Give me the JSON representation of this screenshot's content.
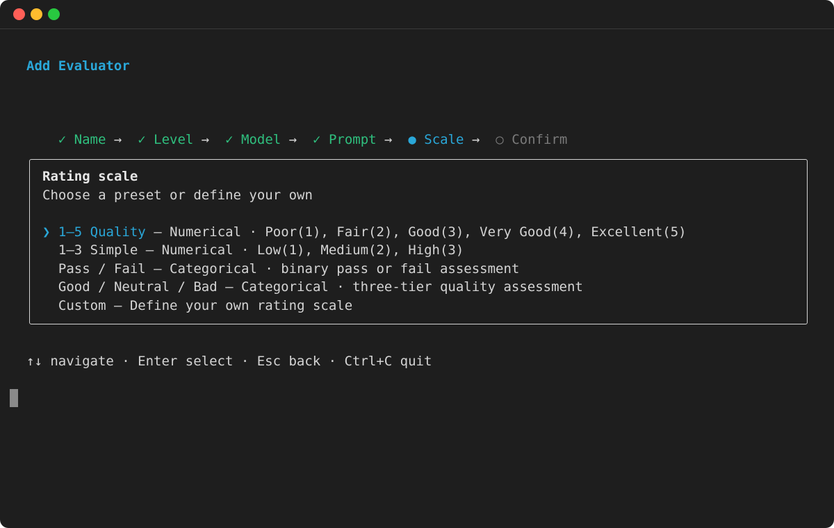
{
  "header": {
    "title": "Add Evaluator"
  },
  "steps": [
    {
      "mark": "✓",
      "label": "Name",
      "state": "done"
    },
    {
      "mark": "✓",
      "label": "Level",
      "state": "done"
    },
    {
      "mark": "✓",
      "label": "Model",
      "state": "done"
    },
    {
      "mark": "✓",
      "label": "Prompt",
      "state": "done"
    },
    {
      "mark": "●",
      "label": "Scale",
      "state": "current"
    },
    {
      "mark": "○",
      "label": "Confirm",
      "state": "pending"
    }
  ],
  "step_separator": "→",
  "panel": {
    "heading": "Rating scale",
    "subheading": "Choose a preset or define your own",
    "selector_glyph": "❯",
    "options": [
      {
        "label": "1–5 Quality",
        "desc": " – Numerical · Poor(1), Fair(2), Good(3), Very Good(4), Excellent(5)",
        "selected": true
      },
      {
        "label": "1–3 Simple",
        "desc": " – Numerical · Low(1), Medium(2), High(3)",
        "selected": false
      },
      {
        "label": "Pass / Fail",
        "desc": " – Categorical · binary pass or fail assessment",
        "selected": false
      },
      {
        "label": "Good / Neutral / Bad",
        "desc": " – Categorical · three-tier quality assessment",
        "selected": false
      },
      {
        "label": "Custom",
        "desc": " – Define your own rating scale",
        "selected": false
      }
    ]
  },
  "help": "↑↓ navigate · Enter select · Esc back · Ctrl+C quit",
  "colors": {
    "background": "#1e1e1e",
    "accent": "#2aa7d8",
    "done": "#2fbf7e",
    "pending": "#7a7a7a",
    "text": "#d4d4d4"
  },
  "icons": {
    "close": "close-traffic-light-icon",
    "minimize": "minimize-traffic-light-icon",
    "maximize": "maximize-traffic-light-icon"
  }
}
